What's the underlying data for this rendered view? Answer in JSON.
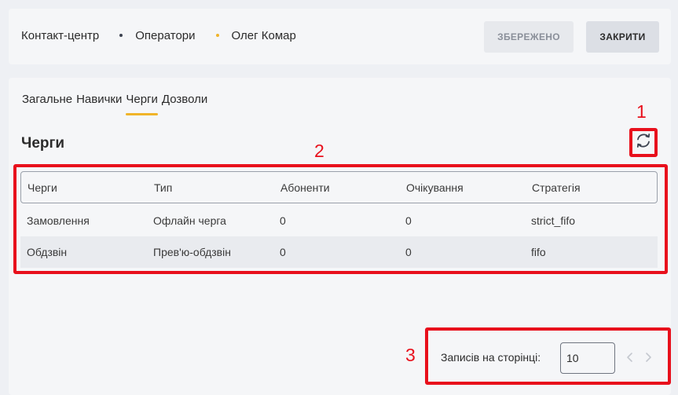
{
  "header": {
    "breadcrumb": [
      "Контакт-центр",
      "Оператори",
      "Олег Комар"
    ],
    "breadcrumb_dot_colors": [
      "#3c4250",
      "#f0b429"
    ],
    "save_label": "ЗБЕРЕЖЕНО",
    "close_label": "ЗАКРИТИ"
  },
  "tabs": [
    {
      "label": "Загальне",
      "active": false
    },
    {
      "label": "Навички",
      "active": false
    },
    {
      "label": "Черги",
      "active": true
    },
    {
      "label": "Дозволи",
      "active": false
    }
  ],
  "section": {
    "title": "Черги",
    "refresh_icon": "refresh-icon"
  },
  "table": {
    "columns": [
      "Черги",
      "Тип",
      "Абоненти",
      "Очікування",
      "Стратегія"
    ],
    "rows": [
      [
        "Замовлення",
        "Офлайн черга",
        "0",
        "0",
        "strict_fifo"
      ],
      [
        "Обдзвін",
        "Прев'ю-обдзвін",
        "0",
        "0",
        "fifo"
      ]
    ]
  },
  "pagination": {
    "label": "Записів на сторінці:",
    "page_size": "10",
    "prev_icon": "chevron-left-icon",
    "next_icon": "chevron-right-icon"
  },
  "annotations": {
    "a1": "1",
    "a2": "2",
    "a3": "3",
    "color": "#e8101c"
  },
  "colors": {
    "accent": "#f0b429",
    "highlight": "#e8101c"
  }
}
